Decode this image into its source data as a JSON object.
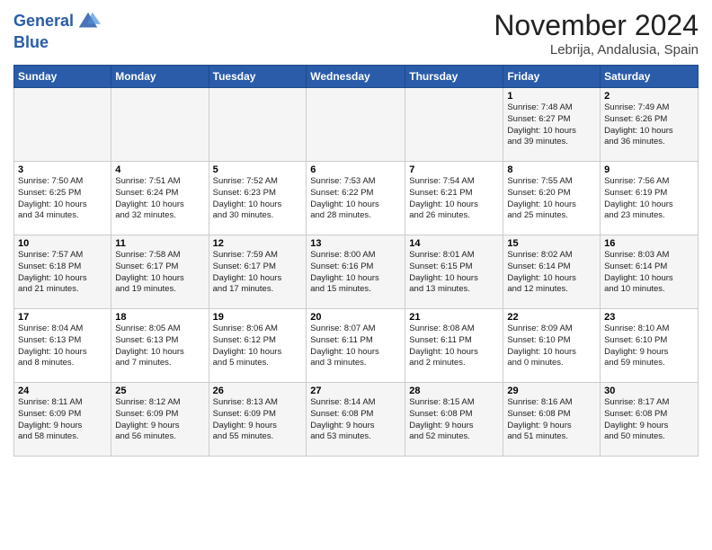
{
  "header": {
    "logo_line1": "General",
    "logo_line2": "Blue",
    "month": "November 2024",
    "location": "Lebrija, Andalusia, Spain"
  },
  "days_of_week": [
    "Sunday",
    "Monday",
    "Tuesday",
    "Wednesday",
    "Thursday",
    "Friday",
    "Saturday"
  ],
  "weeks": [
    [
      {
        "num": "",
        "info": ""
      },
      {
        "num": "",
        "info": ""
      },
      {
        "num": "",
        "info": ""
      },
      {
        "num": "",
        "info": ""
      },
      {
        "num": "",
        "info": ""
      },
      {
        "num": "1",
        "info": "Sunrise: 7:48 AM\nSunset: 6:27 PM\nDaylight: 10 hours\nand 39 minutes."
      },
      {
        "num": "2",
        "info": "Sunrise: 7:49 AM\nSunset: 6:26 PM\nDaylight: 10 hours\nand 36 minutes."
      }
    ],
    [
      {
        "num": "3",
        "info": "Sunrise: 7:50 AM\nSunset: 6:25 PM\nDaylight: 10 hours\nand 34 minutes."
      },
      {
        "num": "4",
        "info": "Sunrise: 7:51 AM\nSunset: 6:24 PM\nDaylight: 10 hours\nand 32 minutes."
      },
      {
        "num": "5",
        "info": "Sunrise: 7:52 AM\nSunset: 6:23 PM\nDaylight: 10 hours\nand 30 minutes."
      },
      {
        "num": "6",
        "info": "Sunrise: 7:53 AM\nSunset: 6:22 PM\nDaylight: 10 hours\nand 28 minutes."
      },
      {
        "num": "7",
        "info": "Sunrise: 7:54 AM\nSunset: 6:21 PM\nDaylight: 10 hours\nand 26 minutes."
      },
      {
        "num": "8",
        "info": "Sunrise: 7:55 AM\nSunset: 6:20 PM\nDaylight: 10 hours\nand 25 minutes."
      },
      {
        "num": "9",
        "info": "Sunrise: 7:56 AM\nSunset: 6:19 PM\nDaylight: 10 hours\nand 23 minutes."
      }
    ],
    [
      {
        "num": "10",
        "info": "Sunrise: 7:57 AM\nSunset: 6:18 PM\nDaylight: 10 hours\nand 21 minutes."
      },
      {
        "num": "11",
        "info": "Sunrise: 7:58 AM\nSunset: 6:17 PM\nDaylight: 10 hours\nand 19 minutes."
      },
      {
        "num": "12",
        "info": "Sunrise: 7:59 AM\nSunset: 6:17 PM\nDaylight: 10 hours\nand 17 minutes."
      },
      {
        "num": "13",
        "info": "Sunrise: 8:00 AM\nSunset: 6:16 PM\nDaylight: 10 hours\nand 15 minutes."
      },
      {
        "num": "14",
        "info": "Sunrise: 8:01 AM\nSunset: 6:15 PM\nDaylight: 10 hours\nand 13 minutes."
      },
      {
        "num": "15",
        "info": "Sunrise: 8:02 AM\nSunset: 6:14 PM\nDaylight: 10 hours\nand 12 minutes."
      },
      {
        "num": "16",
        "info": "Sunrise: 8:03 AM\nSunset: 6:14 PM\nDaylight: 10 hours\nand 10 minutes."
      }
    ],
    [
      {
        "num": "17",
        "info": "Sunrise: 8:04 AM\nSunset: 6:13 PM\nDaylight: 10 hours\nand 8 minutes."
      },
      {
        "num": "18",
        "info": "Sunrise: 8:05 AM\nSunset: 6:13 PM\nDaylight: 10 hours\nand 7 minutes."
      },
      {
        "num": "19",
        "info": "Sunrise: 8:06 AM\nSunset: 6:12 PM\nDaylight: 10 hours\nand 5 minutes."
      },
      {
        "num": "20",
        "info": "Sunrise: 8:07 AM\nSunset: 6:11 PM\nDaylight: 10 hours\nand 3 minutes."
      },
      {
        "num": "21",
        "info": "Sunrise: 8:08 AM\nSunset: 6:11 PM\nDaylight: 10 hours\nand 2 minutes."
      },
      {
        "num": "22",
        "info": "Sunrise: 8:09 AM\nSunset: 6:10 PM\nDaylight: 10 hours\nand 0 minutes."
      },
      {
        "num": "23",
        "info": "Sunrise: 8:10 AM\nSunset: 6:10 PM\nDaylight: 9 hours\nand 59 minutes."
      }
    ],
    [
      {
        "num": "24",
        "info": "Sunrise: 8:11 AM\nSunset: 6:09 PM\nDaylight: 9 hours\nand 58 minutes."
      },
      {
        "num": "25",
        "info": "Sunrise: 8:12 AM\nSunset: 6:09 PM\nDaylight: 9 hours\nand 56 minutes."
      },
      {
        "num": "26",
        "info": "Sunrise: 8:13 AM\nSunset: 6:09 PM\nDaylight: 9 hours\nand 55 minutes."
      },
      {
        "num": "27",
        "info": "Sunrise: 8:14 AM\nSunset: 6:08 PM\nDaylight: 9 hours\nand 53 minutes."
      },
      {
        "num": "28",
        "info": "Sunrise: 8:15 AM\nSunset: 6:08 PM\nDaylight: 9 hours\nand 52 minutes."
      },
      {
        "num": "29",
        "info": "Sunrise: 8:16 AM\nSunset: 6:08 PM\nDaylight: 9 hours\nand 51 minutes."
      },
      {
        "num": "30",
        "info": "Sunrise: 8:17 AM\nSunset: 6:08 PM\nDaylight: 9 hours\nand 50 minutes."
      }
    ]
  ]
}
